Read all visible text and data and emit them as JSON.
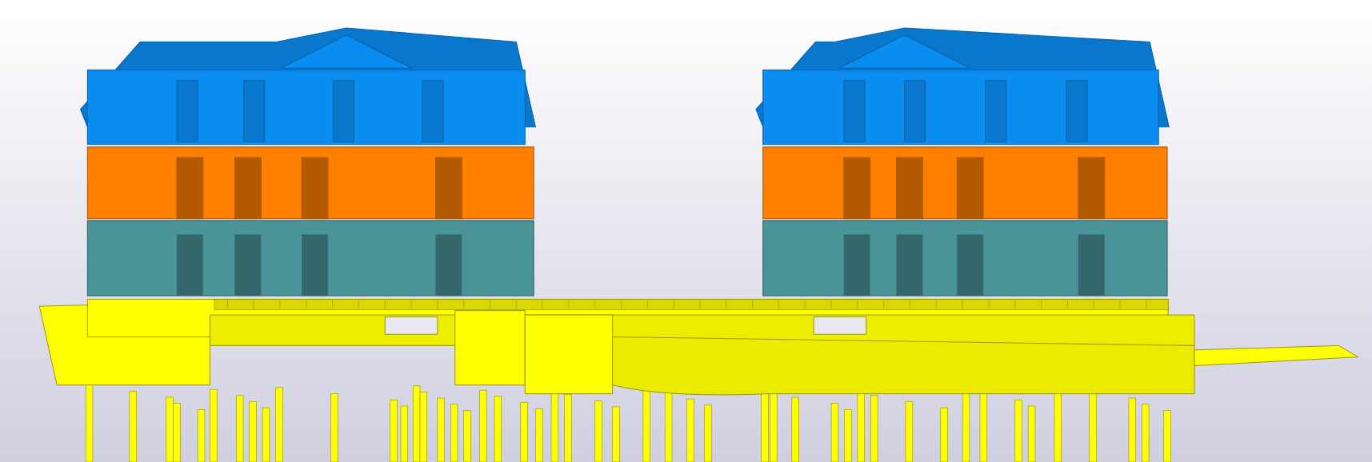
{
  "model_view": {
    "levels": [
      {
        "kind": "roof-storey",
        "color": "#0a8cf0"
      },
      {
        "kind": "middle-storey",
        "color": "#ff8000"
      },
      {
        "kind": "ground-storey",
        "color": "#4a9399"
      },
      {
        "kind": "foundation",
        "color": "#ffff00"
      }
    ]
  }
}
